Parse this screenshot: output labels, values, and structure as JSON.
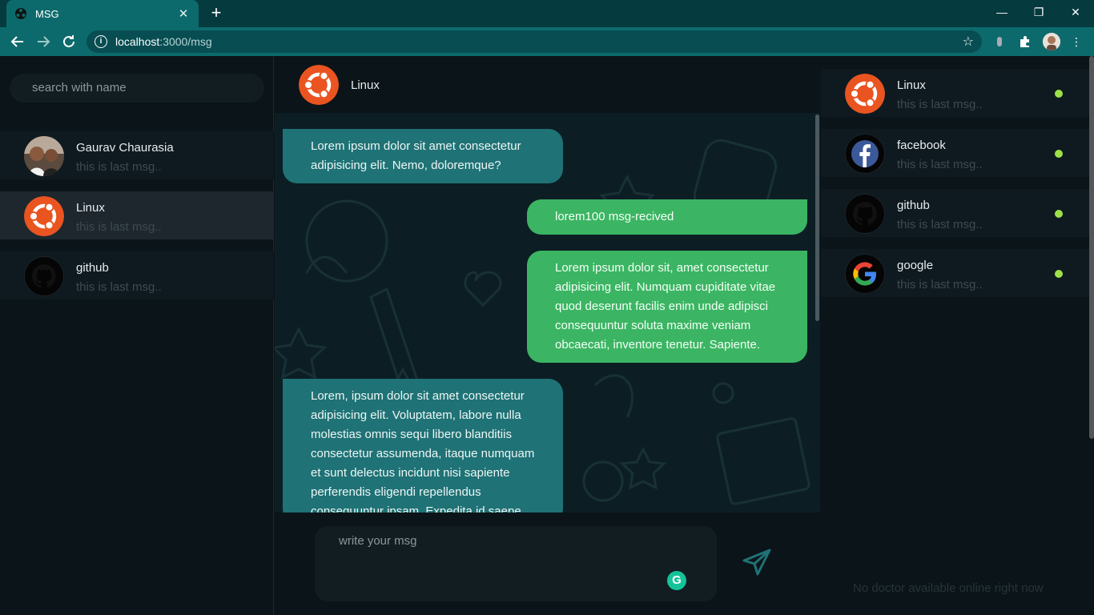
{
  "browser": {
    "tab_title": "MSG",
    "tab_close": "✕",
    "new_tab": "+",
    "url_host": "localhost",
    "url_path": ":3000/msg",
    "min": "—",
    "max": "❐",
    "close": "✕"
  },
  "sidebar": {
    "search_placeholder": "search with name",
    "contacts": [
      {
        "name": "Gaurav Chaurasia",
        "last": "this is last msg.."
      },
      {
        "name": "Linux",
        "last": "this is last msg.."
      },
      {
        "name": "github",
        "last": "this is last msg.."
      }
    ]
  },
  "chat": {
    "header_name": "Linux",
    "messages": [
      {
        "dir": "in",
        "text": "Lorem ipsum dolor sit amet consectetur adipisicing elit. Nemo, doloremque?"
      },
      {
        "dir": "out",
        "text": "lorem100 msg-recived"
      },
      {
        "dir": "out",
        "text": "Lorem ipsum dolor sit, amet consectetur adipisicing elit. Numquam cupiditate vitae quod deserunt facilis enim unde adipisci consequuntur soluta maxime veniam obcaecati, inventore tenetur. Sapiente."
      },
      {
        "dir": "in",
        "text": "Lorem, ipsum dolor sit amet consectetur adipisicing elit. Voluptatem, labore nulla molestias omnis sequi libero blanditiis consectetur assumenda, itaque numquam et sunt delectus incidunt nisi sapiente perferendis eligendi repellendus consequuntur ipsam. Expedita id saepe"
      }
    ],
    "input_placeholder": "write your msg",
    "grammarly_letter": "G"
  },
  "online": {
    "contacts": [
      {
        "name": "Linux",
        "last": "this is last msg.."
      },
      {
        "name": "facebook",
        "last": "this is last msg.."
      },
      {
        "name": "github",
        "last": "this is last msg.."
      },
      {
        "name": "google",
        "last": "this is last msg.."
      }
    ],
    "empty_text": "No doctor available online right now"
  },
  "colors": {
    "accent": "#0d6a6c",
    "incoming_bubble": "#1f7275",
    "outgoing_bubble": "#3bb563",
    "online_dot": "#9de04a"
  }
}
